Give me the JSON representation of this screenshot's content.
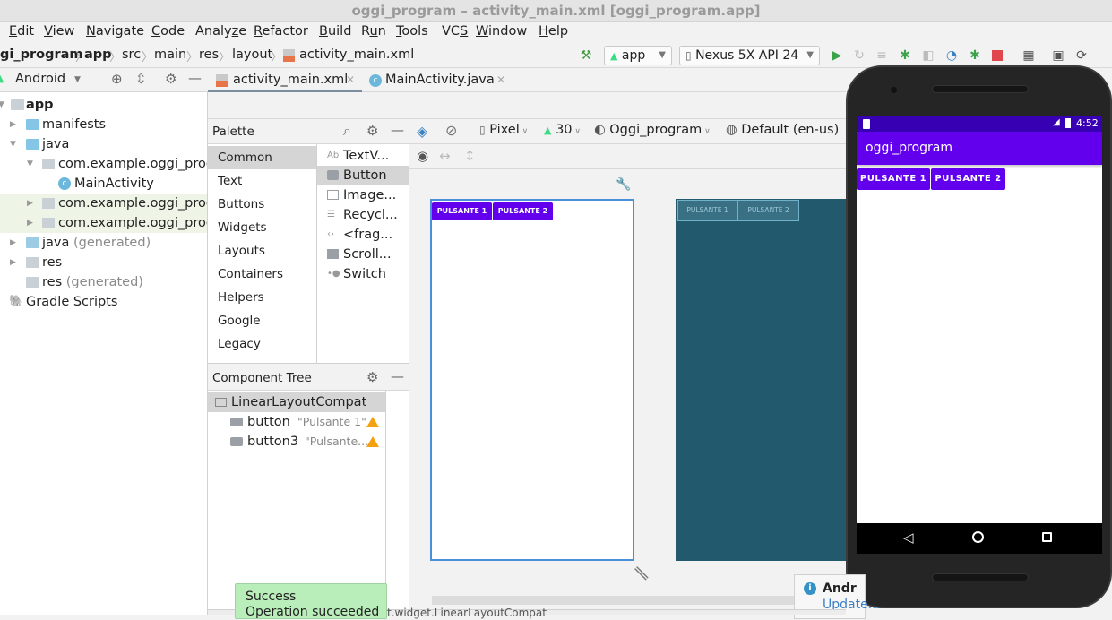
{
  "window": {
    "title": "oggi_program – activity_main.xml [oggi_program.app]"
  },
  "menu": [
    {
      "pre": "",
      "u": "E",
      "post": "dit"
    },
    {
      "pre": "",
      "u": "V",
      "post": "iew"
    },
    {
      "pre": "",
      "u": "N",
      "post": "avigate"
    },
    {
      "pre": "",
      "u": "C",
      "post": "ode"
    },
    {
      "pre": "Analy",
      "u": "z",
      "post": "e"
    },
    {
      "pre": "",
      "u": "R",
      "post": "efactor"
    },
    {
      "pre": "",
      "u": "B",
      "post": "uild"
    },
    {
      "pre": "R",
      "u": "u",
      "post": "n"
    },
    {
      "pre": "",
      "u": "T",
      "post": "ools"
    },
    {
      "pre": "VC",
      "u": "S",
      "post": ""
    },
    {
      "pre": "",
      "u": "W",
      "post": "indow"
    },
    {
      "pre": "",
      "u": "H",
      "post": "elp"
    }
  ],
  "breadcrumb": [
    "gi_program",
    "app",
    "src",
    "main",
    "res",
    "layout",
    "activity_main.xml"
  ],
  "toolbar": {
    "run_config": "app",
    "device": "Nexus 5X API 24"
  },
  "project": {
    "view_mode": "Android",
    "tree": [
      {
        "label": "app",
        "bold": true
      },
      {
        "label": "manifests"
      },
      {
        "label": "java"
      },
      {
        "label": "com.example.oggi_prog"
      },
      {
        "label": "MainActivity"
      },
      {
        "label": "com.example.oggi_prog"
      },
      {
        "label": "com.example.oggi_prog"
      },
      {
        "label": "java",
        "suffix": "(generated)"
      },
      {
        "label": "res"
      },
      {
        "label": "res",
        "suffix": "(generated)"
      },
      {
        "label": "Gradle Scripts"
      }
    ]
  },
  "editor_tabs": [
    {
      "label": "activity_main.xml",
      "active": true
    },
    {
      "label": "MainActivity.java",
      "active": false
    }
  ],
  "palette": {
    "title": "Palette",
    "categories": [
      "Common",
      "Text",
      "Buttons",
      "Widgets",
      "Layouts",
      "Containers",
      "Helpers",
      "Google",
      "Legacy"
    ],
    "selected_category": "Common",
    "items": [
      "TextV...",
      "Button",
      "Image...",
      "Recycl...",
      "<frag...",
      "Scroll...",
      "Switch"
    ],
    "selected_item": "Button"
  },
  "component_tree": {
    "title": "Component Tree",
    "root": "LinearLayoutCompat",
    "children": [
      {
        "id": "button",
        "text": "\"Pulsante 1\""
      },
      {
        "id": "button3",
        "text": "\"Pulsante..."
      }
    ]
  },
  "design_toolbar": {
    "device": "Pixel",
    "api": "30",
    "theme": "Oggi_program",
    "locale": "Default (en-us)"
  },
  "design": {
    "buttons": [
      "PULSANTE 1",
      "PULSANTE 2"
    ],
    "accent": "#6200ee"
  },
  "emulator": {
    "time": "4:52",
    "app_title": "oggi_program",
    "buttons": [
      "PULSANTE 1",
      "PULSANTE 2"
    ],
    "status_bar_color": "#3700b3",
    "app_bar_color": "#6200ee"
  },
  "toast": {
    "title": "Success",
    "message": "Operation succeeded"
  },
  "notification": {
    "title": "Andr",
    "link": "Update..."
  },
  "status_text": "t.widget.LinearLayoutCompat"
}
